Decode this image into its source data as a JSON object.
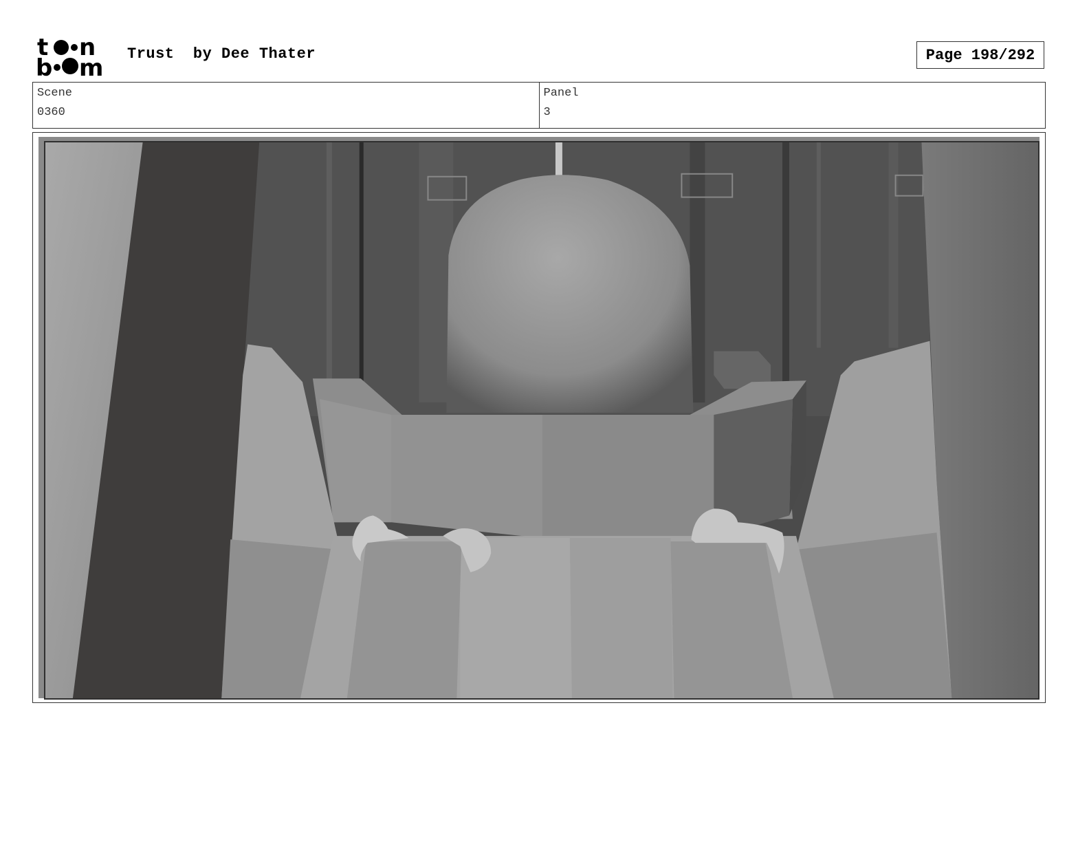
{
  "header": {
    "logo_text": "toon boom",
    "title": "Trust  by Dee Thater",
    "page": "Page 198/292"
  },
  "info": {
    "scene_label": "Scene",
    "scene_value": "0360",
    "panel_label": "Panel",
    "panel_value": "3"
  },
  "panel": {
    "image": "storyboard-frame",
    "colors": {
      "dark_pillar": "#3f3d3c",
      "dome": "#9a9a9a",
      "background": "#4a4a4a"
    }
  }
}
